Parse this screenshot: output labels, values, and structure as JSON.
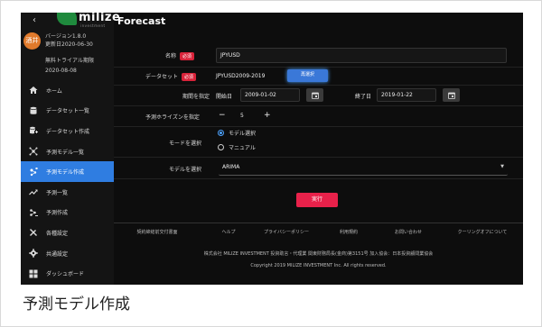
{
  "app": {
    "brand": "milize",
    "brand_sub": "investment",
    "title": "Forecast",
    "back": "‹"
  },
  "user": {
    "avatar": "酒井",
    "version": "バージョン1.8.0",
    "updated": "更新日2020-06-30",
    "trial": "無料トライアル期限",
    "trial_date": "2020-08-08"
  },
  "nav": [
    {
      "label": "ホーム",
      "icon": "home-icon",
      "active": false
    },
    {
      "label": "データセット一覧",
      "icon": "database-icon",
      "active": false
    },
    {
      "label": "データセット作成",
      "icon": "database-add-icon",
      "active": false
    },
    {
      "label": "予測モデル一覧",
      "icon": "model-list-icon",
      "active": false
    },
    {
      "label": "予測モデル作成",
      "icon": "model-create-icon",
      "active": true
    },
    {
      "label": "予測一覧",
      "icon": "trend-icon",
      "active": false
    },
    {
      "label": "予測作成",
      "icon": "forecast-create-icon",
      "active": false
    },
    {
      "label": "各種設定",
      "icon": "tools-icon",
      "active": false
    },
    {
      "label": "共通設定",
      "icon": "gear-icon",
      "active": false
    },
    {
      "label": "ダッシュボード",
      "icon": "dashboard-icon",
      "active": false
    }
  ],
  "form": {
    "name_label": "名称",
    "required": "必須",
    "name_value": "JPYUSD",
    "dataset_label": "データセット",
    "dataset_value": "JPYUSD2009-2019",
    "reselect": "再選択",
    "period_label": "期間を指定",
    "start_label": "開始日",
    "start_value": "2009-01-02",
    "end_label": "終了日",
    "end_value": "2019-01-22",
    "horizon_label": "予測ホライズンを指定",
    "minus": "−",
    "horizon_value": "5",
    "plus": "+",
    "mode_label": "モードを選択",
    "mode_options": [
      "モデル選択",
      "マニュアル"
    ],
    "mode_selected": "モデル選択",
    "model_label": "モデルを選択",
    "model_value": "ARIMA",
    "run": "実行"
  },
  "footer": {
    "links": [
      "契約締結前交付書面",
      "ヘルプ",
      "プライバシーポリシー",
      "利用規約",
      "お問い合わせ",
      "クーリングオフについて"
    ],
    "company": "株式会社 MILIZE INVESTMENT 投資助言・代理業 関東財務局長(金商)第3151号 加入協会：日本投資顧問業協会",
    "copyright": "Copyright 2019 MILIZE INVESTMENT Inc. All rights reserved."
  },
  "caption": "予測モデル作成",
  "colors": {
    "accent": "#2f7de1",
    "required": "#d9233a",
    "run": "#e8214a",
    "brand": "#1f8a3d"
  }
}
